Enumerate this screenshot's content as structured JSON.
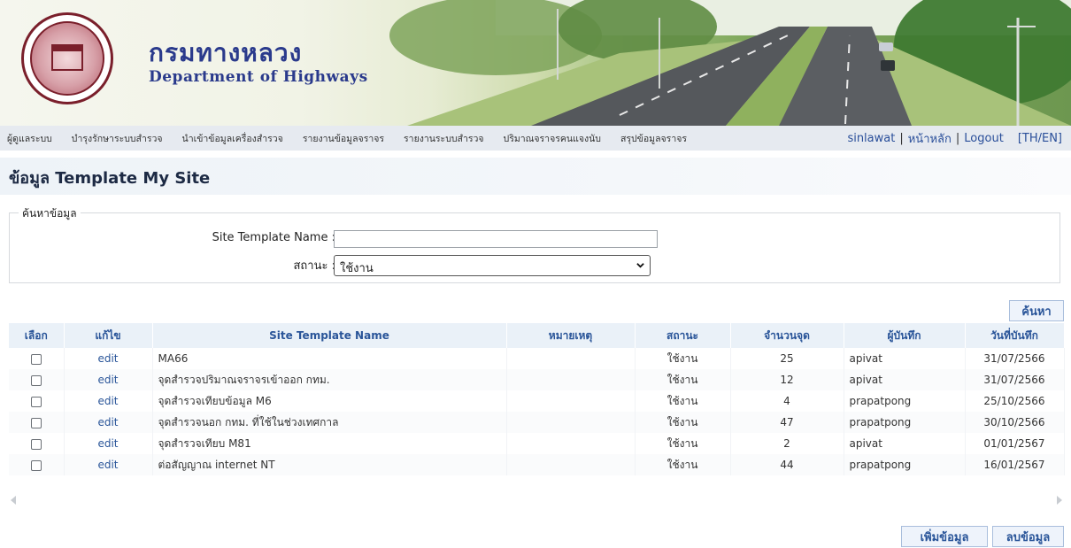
{
  "header": {
    "org_name_th": "กรมทางหลวง",
    "org_name_en": "Department of Highways"
  },
  "nav": {
    "menu": [
      "ผู้ดูแลระบบ",
      "บำรุงรักษาระบบสำรวจ",
      "นำเข้าข้อมูลเครื่องสำรวจ",
      "รายงานข้อมูลจราจร",
      "รายงานระบบสำรวจ",
      "ปริมาณจราจรคนแจงนับ",
      "สรุปข้อมูลจราจร"
    ],
    "username": "sinlawat",
    "sep": "|",
    "home": "หน้าหลัก",
    "logout": "Logout",
    "lang": "[TH/EN]"
  },
  "page": {
    "title": "ข้อมูล Template My Site"
  },
  "search": {
    "legend": "ค้นหาข้อมูล",
    "name_label": "Site Template Name :",
    "name_value": "",
    "status_label": "สถานะ :",
    "status_value": "ใช้งาน",
    "search_button": "ค้นหา"
  },
  "table": {
    "headers": [
      "เลือก",
      "แก้ไข",
      "Site Template Name",
      "หมายเหตุ",
      "สถานะ",
      "จำนวนจุด",
      "ผู้บันทึก",
      "วันที่บันทึก"
    ],
    "edit_label": "edit",
    "rows": [
      {
        "name": "MA66",
        "note": "",
        "status": "ใช้งาน",
        "count": "25",
        "user": "apivat",
        "date": "31/07/2566"
      },
      {
        "name": "จุดสำรวจปริมาณจราจรเข้าออก กทม.",
        "note": "",
        "status": "ใช้งาน",
        "count": "12",
        "user": "apivat",
        "date": "31/07/2566"
      },
      {
        "name": "จุดสำรวจเทียบข้อมูล M6",
        "note": "",
        "status": "ใช้งาน",
        "count": "4",
        "user": "prapatpong",
        "date": "25/10/2566"
      },
      {
        "name": "จุดสำรวจนอก กทม. ที่ใช้ในช่วงเทศกาล",
        "note": "",
        "status": "ใช้งาน",
        "count": "47",
        "user": "prapatpong",
        "date": "30/10/2566"
      },
      {
        "name": "จุดสำรวจเทียบ M81",
        "note": "",
        "status": "ใช้งาน",
        "count": "2",
        "user": "apivat",
        "date": "01/01/2567"
      },
      {
        "name": "ต่อสัญญาณ internet NT",
        "note": "",
        "status": "ใช้งาน",
        "count": "44",
        "user": "prapatpong",
        "date": "16/01/2567"
      }
    ]
  },
  "actions": {
    "add": "เพิ่มข้อมูล",
    "delete": "ลบข้อมูล"
  }
}
